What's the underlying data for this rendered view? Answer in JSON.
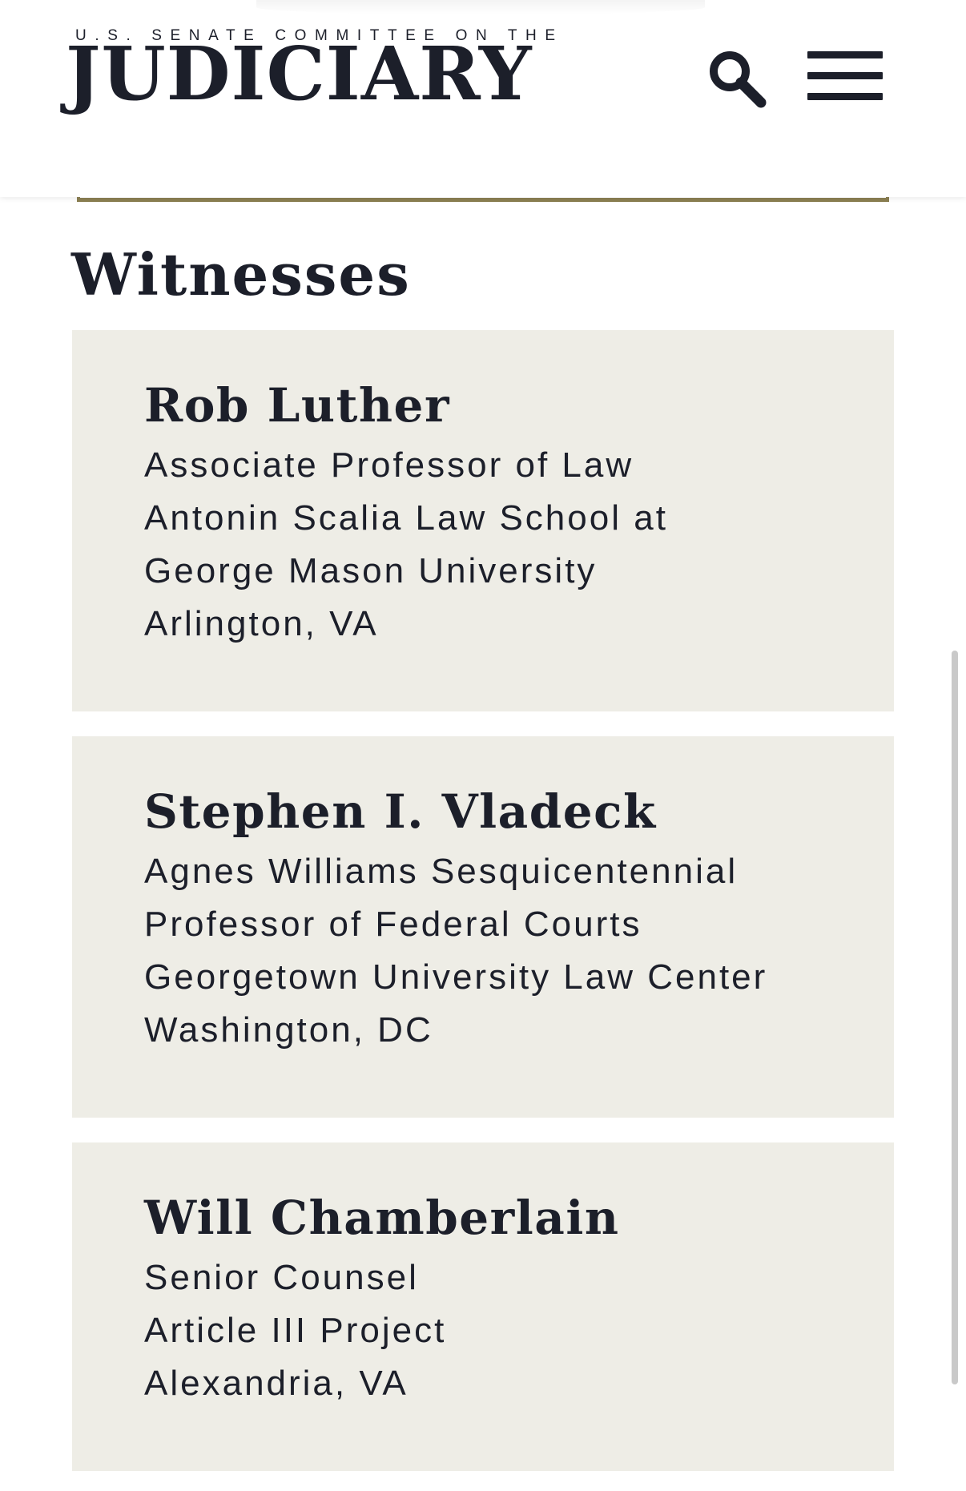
{
  "header": {
    "overline": "U.S. SENATE COMMITTEE ON THE",
    "wordmark": "JUDICIARY",
    "icons": {
      "search": "search-icon",
      "menu": "hamburger-menu-icon"
    }
  },
  "colors": {
    "text": "#1c1f2a",
    "accent_gold": "#8b7f52",
    "card_bg": "#eeede6",
    "scrollbar": "#c9c9c9"
  },
  "section": {
    "title": "Witnesses",
    "witnesses": [
      {
        "name": "Rob Luther",
        "lines": [
          "Associate Professor of Law",
          "Antonin Scalia Law School at",
          "George Mason University",
          "Arlington, VA"
        ]
      },
      {
        "name": "Stephen I. Vladeck",
        "lines": [
          "Agnes Williams Sesquicentennial",
          "Professor of Federal Courts",
          "Georgetown University Law Center",
          "Washington, DC"
        ]
      },
      {
        "name": "Will Chamberlain",
        "lines": [
          "Senior Counsel",
          "Article III Project",
          "Alexandria, VA"
        ]
      }
    ]
  }
}
